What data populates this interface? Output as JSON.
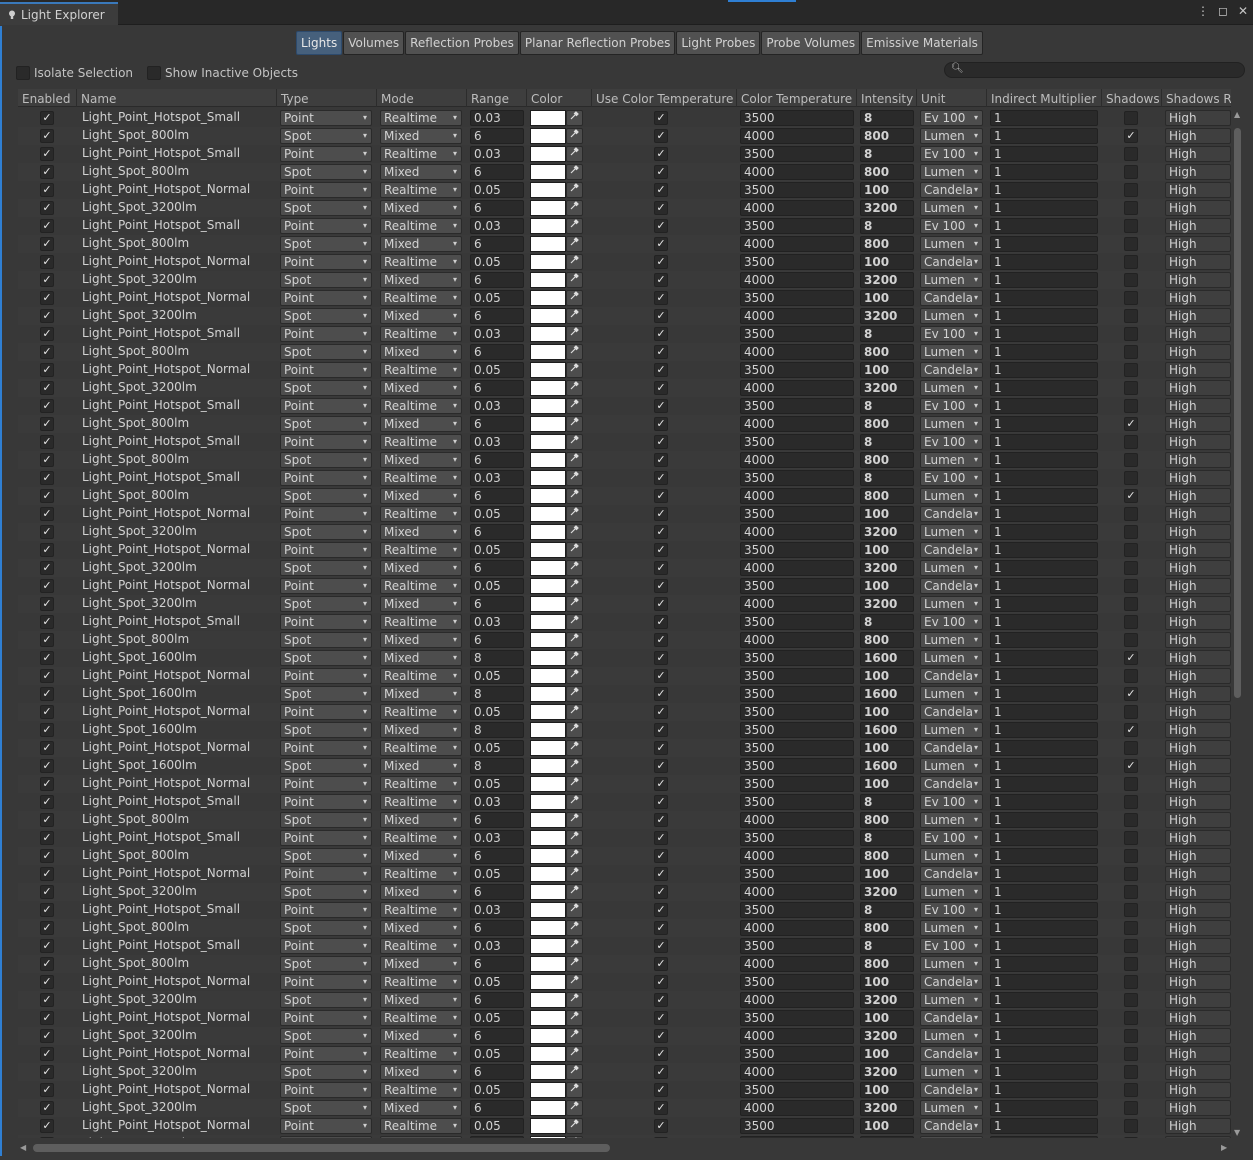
{
  "window": {
    "title": "Light Explorer",
    "menu_icon": "kebab-menu-icon",
    "maximize_icon": "maximize-icon",
    "close_icon": "close-icon"
  },
  "toolbar": {
    "tabs": [
      "Lights",
      "Volumes",
      "Reflection Probes",
      "Planar Reflection Probes",
      "Light Probes",
      "Probe Volumes",
      "Emissive Materials"
    ],
    "selected": "Lights"
  },
  "options": {
    "isolate": "Isolate Selection",
    "inactive": "Show Inactive Objects"
  },
  "search": {
    "placeholder": "",
    "icon": "search-icon"
  },
  "columns": [
    "Enabled",
    "Name",
    "Type",
    "Mode",
    "Range",
    "Color",
    "Use Color Temperature",
    "Color Temperature",
    "Intensity",
    "Unit",
    "Indirect Multiplier",
    "Shadows",
    "Shadows Resolution"
  ],
  "columns_visible": [
    "Enabled",
    "Name",
    "Type",
    "Mode",
    "Range",
    "Color",
    "Use Color Temperature",
    "Color Temperature",
    "Intensity",
    "Unit",
    "Indirect Multiplier",
    "Shadows",
    "Shadows Res"
  ],
  "presets": {
    "PS": {
      "name": "Light_Point_Hotspot_Small",
      "type": "Point",
      "mode": "Realtime",
      "range": "0.03",
      "temp": "3500",
      "intensity": "8",
      "unit": "Ev 100"
    },
    "S8": {
      "name": "Light_Spot_800lm",
      "type": "Spot",
      "mode": "Mixed",
      "range": "6",
      "temp": "4000",
      "intensity": "800",
      "unit": "Lumen"
    },
    "PN": {
      "name": "Light_Point_Hotspot_Normal",
      "type": "Point",
      "mode": "Realtime",
      "range": "0.05",
      "temp": "3500",
      "intensity": "100",
      "unit": "Candela"
    },
    "S32": {
      "name": "Light_Spot_3200lm",
      "type": "Spot",
      "mode": "Mixed",
      "range": "6",
      "temp": "4000",
      "intensity": "3200",
      "unit": "Lumen"
    },
    "S16": {
      "name": "Light_Spot_1600lm",
      "type": "Spot",
      "mode": "Mixed",
      "range": "8",
      "temp": "3500",
      "intensity": "1600",
      "unit": "Lumen"
    }
  },
  "row_defaults": {
    "enabled": true,
    "color": "#ffffff",
    "use_temp": true,
    "indirect": "1",
    "shadow_res": "High"
  },
  "rows": [
    [
      "PS",
      0
    ],
    [
      "S8",
      1
    ],
    [
      "PS",
      0
    ],
    [
      "S8",
      0
    ],
    [
      "PN",
      0
    ],
    [
      "S32",
      0
    ],
    [
      "PS",
      0
    ],
    [
      "S8",
      0
    ],
    [
      "PN",
      0
    ],
    [
      "S32",
      0
    ],
    [
      "PN",
      0
    ],
    [
      "S32",
      0
    ],
    [
      "PS",
      0
    ],
    [
      "S8",
      0
    ],
    [
      "PN",
      0
    ],
    [
      "S32",
      0
    ],
    [
      "PS",
      0
    ],
    [
      "S8",
      1
    ],
    [
      "PS",
      0
    ],
    [
      "S8",
      0
    ],
    [
      "PS",
      0
    ],
    [
      "S8",
      1
    ],
    [
      "PN",
      0
    ],
    [
      "S32",
      0
    ],
    [
      "PN",
      0
    ],
    [
      "S32",
      0
    ],
    [
      "PN",
      0
    ],
    [
      "S32",
      0
    ],
    [
      "PS",
      0
    ],
    [
      "S8",
      0
    ],
    [
      "S16",
      1
    ],
    [
      "PN",
      0
    ],
    [
      "S16",
      1
    ],
    [
      "PN",
      0
    ],
    [
      "S16",
      1
    ],
    [
      "PN",
      0
    ],
    [
      "S16",
      1
    ],
    [
      "PN",
      0
    ],
    [
      "PS",
      0
    ],
    [
      "S8",
      0
    ],
    [
      "PS",
      0
    ],
    [
      "S8",
      0
    ],
    [
      "PN",
      0
    ],
    [
      "S32",
      0
    ],
    [
      "PS",
      0
    ],
    [
      "S8",
      0
    ],
    [
      "PS",
      0
    ],
    [
      "S8",
      0
    ],
    [
      "PN",
      0
    ],
    [
      "S32",
      0
    ],
    [
      "PN",
      0
    ],
    [
      "S32",
      0
    ],
    [
      "PN",
      0
    ],
    [
      "S32",
      0
    ],
    [
      "PN",
      0
    ],
    [
      "S32",
      0
    ],
    [
      "PN",
      0
    ],
    [
      "S32",
      0
    ]
  ],
  "icons": {
    "checkmark": "✓",
    "dropdown": "▾",
    "eyedropper": "eyedropper-icon",
    "light": "light-bulb-icon"
  }
}
